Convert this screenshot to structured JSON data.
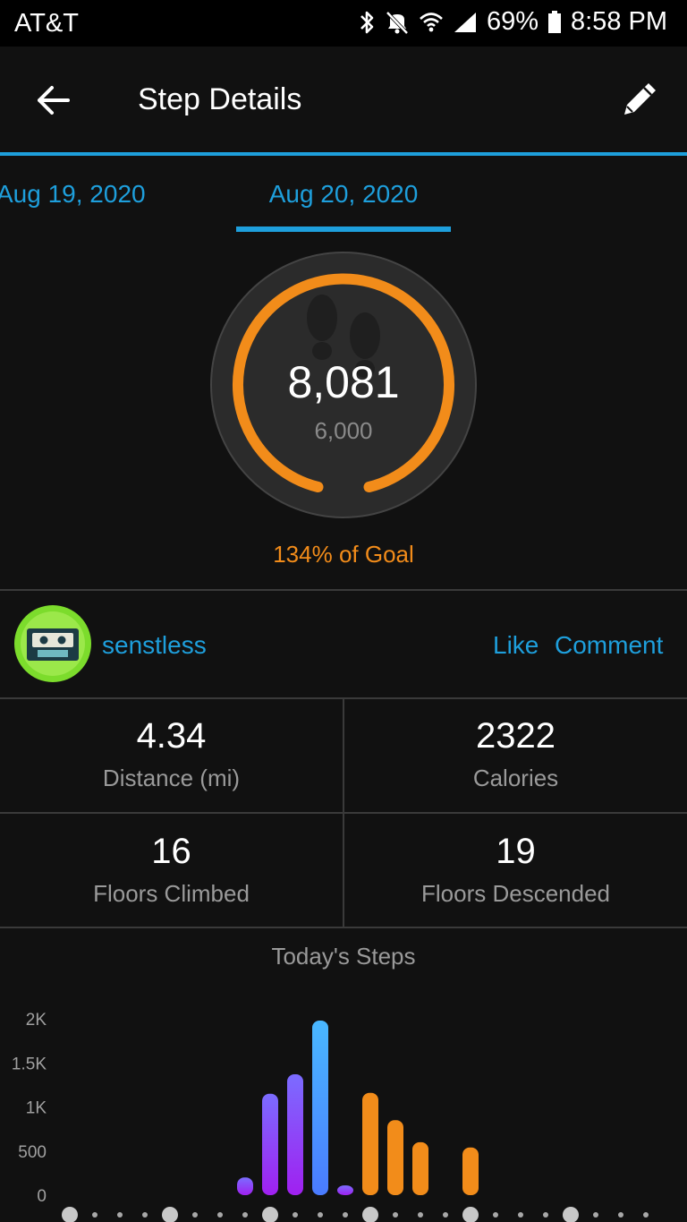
{
  "status_bar": {
    "carrier": "AT&T",
    "battery": "69%",
    "time": "8:58 PM"
  },
  "app_bar": {
    "title": "Step Details"
  },
  "date_tabs": {
    "previous": "Aug 19, 2020",
    "current": "Aug 20, 2020"
  },
  "summary": {
    "steps": "8,081",
    "goal": "6,000",
    "goal_percent_label": "134% of Goal",
    "ring_color": "#f28c1a"
  },
  "social": {
    "username": "senstless",
    "like_label": "Like",
    "comment_label": "Comment"
  },
  "stats": [
    {
      "value": "4.34",
      "label": "Distance (mi)"
    },
    {
      "value": "2322",
      "label": "Calories"
    },
    {
      "value": "16",
      "label": "Floors Climbed"
    },
    {
      "value": "19",
      "label": "Floors Descended"
    }
  ],
  "chart_title": "Today's Steps",
  "colors": {
    "accent": "#1e9fdc",
    "orange": "#f28c1a",
    "purple": "#a020f0",
    "blue": "#4aa8ff"
  },
  "chart_data": {
    "type": "bar",
    "title": "Today's Steps",
    "ylim": [
      0,
      2000
    ],
    "yticks": [
      {
        "value": 0,
        "label": "0"
      },
      {
        "value": 500,
        "label": "500"
      },
      {
        "value": 1000,
        "label": "1K"
      },
      {
        "value": 1500,
        "label": "1.5K"
      },
      {
        "value": 2000,
        "label": "2K"
      }
    ],
    "grid": false,
    "slot_count": 24,
    "bars": [
      {
        "slot": 7,
        "value": 200,
        "color": "purple"
      },
      {
        "slot": 8,
        "value": 1150,
        "color": "purple"
      },
      {
        "slot": 9,
        "value": 1370,
        "color": "purple"
      },
      {
        "slot": 10,
        "value": 1980,
        "color": "blue"
      },
      {
        "slot": 11,
        "value": 110,
        "color": "purple"
      },
      {
        "slot": 12,
        "value": 1160,
        "color": "orange"
      },
      {
        "slot": 13,
        "value": 850,
        "color": "orange"
      },
      {
        "slot": 14,
        "value": 600,
        "color": "orange"
      },
      {
        "slot": 16,
        "value": 540,
        "color": "orange"
      }
    ]
  }
}
